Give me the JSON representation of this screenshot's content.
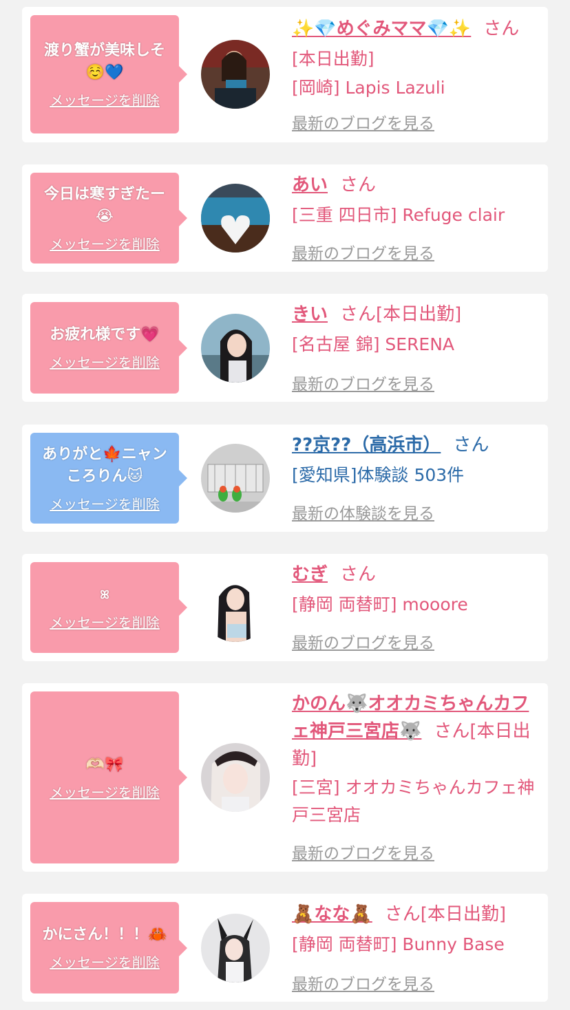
{
  "cards": [
    {
      "bubble_msg": "渡り蟹が美味しそ☺️💙",
      "delete_label": "メッセージを削除",
      "name": "✨💎めぐみママ💎✨",
      "san": "さん",
      "status": "[本日出勤]",
      "shop": "[岡崎] Lapis Lazuli",
      "link": "最新のブログを見る"
    },
    {
      "bubble_msg": "今日は寒すぎたー😭",
      "delete_label": "メッセージを削除",
      "name": "あい",
      "san": "さん",
      "shop": "[三重 四日市] Refuge clair",
      "link": "最新のブログを見る"
    },
    {
      "bubble_msg": "お疲れ様です💗",
      "delete_label": "メッセージを削除",
      "name": "きい",
      "san": "さん[本日出勤]",
      "shop": "[名古屋 錦] SERENA",
      "link": "最新のブログを見る"
    },
    {
      "bubble_msg": "ありがと🍁ニャンころりん🐱",
      "delete_label": "メッセージを削除",
      "name": "??京??（高浜市）",
      "san": "さん",
      "shop": "[愛知県]体験談 503件",
      "link": "最新の体験談を見る"
    },
    {
      "bubble_msg": "ꕤ",
      "delete_label": "メッセージを削除",
      "name": "むぎ",
      "san": "さん",
      "shop": "[静岡 両替町] mooore",
      "link": "最新のブログを見る"
    },
    {
      "bubble_msg": "🫶🏻🎀",
      "delete_label": "メッセージを削除",
      "name": "かのん🐺オオカミちゃんカフェ神戸三宮店🐺",
      "san": "さん[本日出勤]",
      "shop": "[三宮] オオカミちゃんカフェ神戸三宮店",
      "link": "最新のブログを見る"
    },
    {
      "bubble_msg": "かにさん！！！🦀",
      "delete_label": "メッセージを削除",
      "name": "🧸なな🧸",
      "san": "さん[本日出勤]",
      "shop": "[静岡 両替町] Bunny Base",
      "link": "最新のブログを見る"
    }
  ],
  "colors": {
    "pink_bubble": "#f99bab",
    "blue_bubble": "#8ab9f2",
    "pink_text": "#e2577a",
    "blue_text": "#2b6aa8",
    "link_gray": "#999999"
  }
}
